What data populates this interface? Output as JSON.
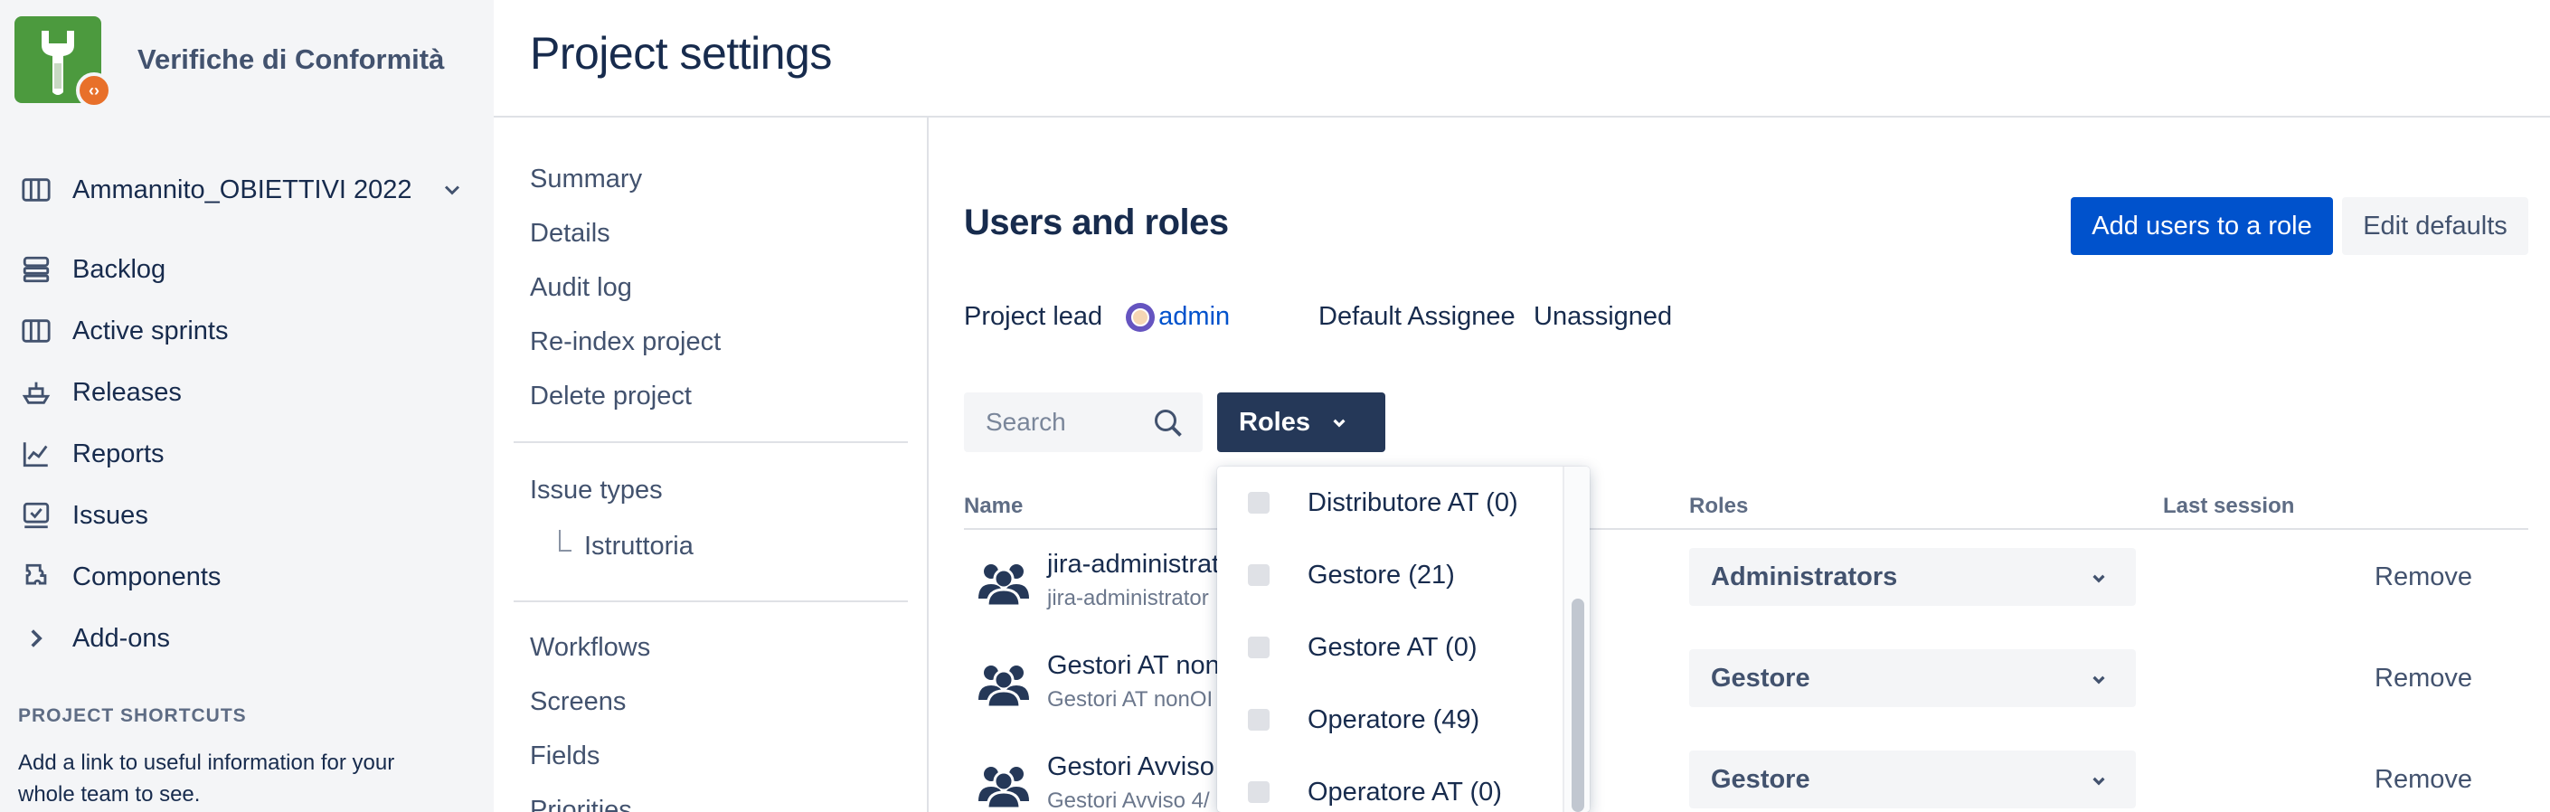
{
  "project": {
    "name": "Verifiche di Conformità"
  },
  "sidebar": {
    "board_name": "Ammannito_OBIETTIVI 2022",
    "items": [
      {
        "label": "Backlog",
        "icon": "backlog-icon"
      },
      {
        "label": "Active sprints",
        "icon": "board-icon"
      },
      {
        "label": "Releases",
        "icon": "ship-icon"
      },
      {
        "label": "Reports",
        "icon": "graph-icon"
      },
      {
        "label": "Issues",
        "icon": "issues-icon"
      },
      {
        "label": "Components",
        "icon": "component-icon"
      },
      {
        "label": "Add-ons",
        "icon": "chevron-right-icon"
      }
    ],
    "shortcuts_title": "PROJECT SHORTCUTS",
    "shortcuts_desc": "Add a link to useful information for your whole team to see."
  },
  "header": {
    "title": "Project settings"
  },
  "settings_nav": {
    "items": [
      "Summary",
      "Details",
      "Audit log",
      "Re-index project",
      "Delete project"
    ],
    "issue_types": "Issue types",
    "issue_type_children": [
      "Istruttoria"
    ],
    "items2": [
      "Workflows",
      "Screens",
      "Fields",
      "Priorities"
    ]
  },
  "main": {
    "title": "Users and roles",
    "add_button": "Add users to a role",
    "edit_defaults": "Edit defaults",
    "project_lead_label": "Project lead",
    "project_lead_value": "admin",
    "default_assignee_label": "Default Assignee",
    "default_assignee_value": "Unassigned",
    "search_placeholder": "Search",
    "roles_button": "Roles",
    "columns": {
      "name": "Name",
      "roles": "Roles",
      "last_session": "Last session"
    },
    "rows": [
      {
        "name": "jira-administrat",
        "sub": "jira-administrator",
        "role": "Administrators",
        "action": "Remove"
      },
      {
        "name": "Gestori AT non",
        "sub": "Gestori AT nonOI",
        "role": "Gestore",
        "action": "Remove"
      },
      {
        "name": "Gestori Avviso",
        "sub": "Gestori Avviso 4/",
        "role": "Gestore",
        "action": "Remove"
      }
    ]
  },
  "roles_dropdown": {
    "options": [
      {
        "label": "Distributore AT (0)",
        "checked": false
      },
      {
        "label": "Gestore (21)",
        "checked": false
      },
      {
        "label": "Gestore AT (0)",
        "checked": false
      },
      {
        "label": "Operatore (49)",
        "checked": false
      },
      {
        "label": "Operatore AT (0)",
        "checked": false
      }
    ]
  },
  "colors": {
    "primary": "#0052cc",
    "roles_button": "#253858",
    "sidebar_bg": "#f4f5f7",
    "project_avatar": "#4c9a3e",
    "avatar_badge": "#e8702a"
  }
}
